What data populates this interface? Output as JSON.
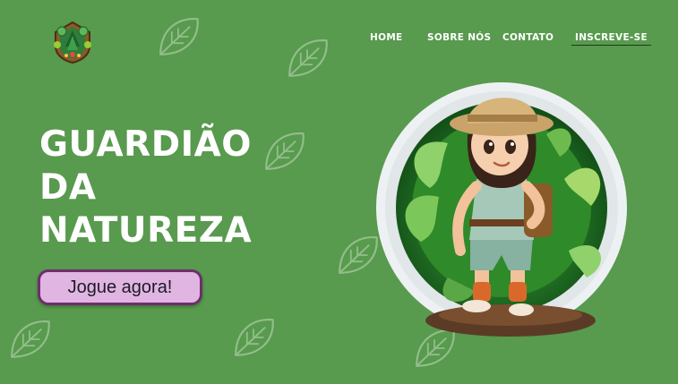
{
  "nav": {
    "items": [
      {
        "label": "HOME"
      },
      {
        "label": "SOBRE NÓS"
      },
      {
        "label": "CONTATO"
      },
      {
        "label": "INSCREVE-SE"
      }
    ]
  },
  "hero": {
    "title_lines": [
      "GUARDIÃO",
      "DA",
      "NATUREZA"
    ],
    "cta_label": "Jogue agora!"
  },
  "colors": {
    "background": "#589a4e",
    "cta_fill": "#e0b5e2",
    "cta_border": "#6d2f6e",
    "nav_underline": "#1c3a16"
  },
  "icons": {
    "logo": "forest-shield-logo",
    "background": "leaf-icon",
    "hero": "explorer-girl-illustration"
  }
}
